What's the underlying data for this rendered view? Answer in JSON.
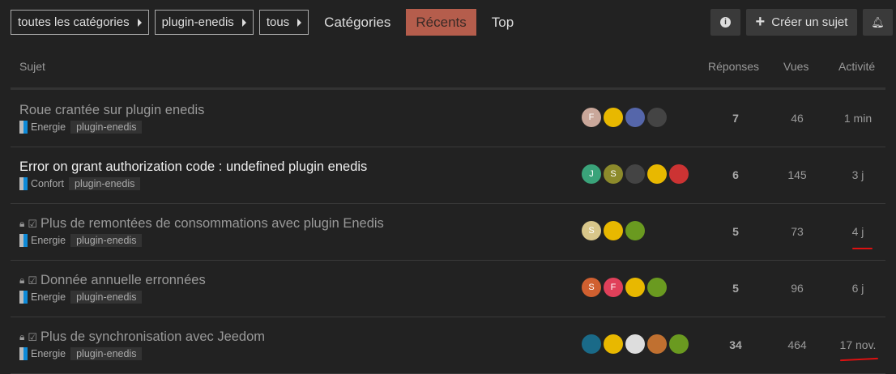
{
  "nav": {
    "crumbs": [
      "toutes les catégories",
      "plugin-enedis",
      "tous"
    ],
    "links": [
      "Catégories",
      "Récents",
      "Top"
    ],
    "active": "Récents"
  },
  "actions": {
    "info_icon": "info-icon",
    "create": "Créer un sujet",
    "bell_icon": "bell-icon"
  },
  "headers": {
    "topic": "Sujet",
    "replies": "Réponses",
    "views": "Vues",
    "activity": "Activité"
  },
  "topics": [
    {
      "title": "Roue crantée sur plugin enedis",
      "category": "Energie",
      "tag": "plugin-enedis",
      "replies": "7",
      "views": "46",
      "activity": "1 min",
      "locked": false,
      "bold": false,
      "avatars": [
        {
          "t": "F",
          "c": "#c9a79a"
        },
        {
          "t": "",
          "c": "#e8b800"
        },
        {
          "t": "",
          "c": "#5566aa"
        },
        {
          "t": "",
          "c": "#444"
        }
      ]
    },
    {
      "title": "Error on grant authorization code : undefined plugin enedis",
      "category": "Confort",
      "tag": "plugin-enedis",
      "replies": "6",
      "views": "145",
      "activity": "3 j",
      "locked": false,
      "bold": true,
      "avatars": [
        {
          "t": "J",
          "c": "#3aa37a"
        },
        {
          "t": "S",
          "c": "#8c8a2b"
        },
        {
          "t": "",
          "c": "#444"
        },
        {
          "t": "",
          "c": "#e8b800"
        },
        {
          "t": "",
          "c": "#c33"
        }
      ]
    },
    {
      "title": "Plus de remontées de consommations avec plugin Enedis",
      "category": "Energie",
      "tag": "plugin-enedis",
      "replies": "5",
      "views": "73",
      "activity": "4 j",
      "locked": true,
      "bold": false,
      "avatars": [
        {
          "t": "S",
          "c": "#d8c68a"
        },
        {
          "t": "",
          "c": "#e8b800"
        },
        {
          "t": "",
          "c": "#6a9a20"
        }
      ]
    },
    {
      "title": "Donnée annuelle erronnées",
      "category": "Energie",
      "tag": "plugin-enedis",
      "replies": "5",
      "views": "96",
      "activity": "6 j",
      "locked": true,
      "bold": false,
      "avatars": [
        {
          "t": "S",
          "c": "#d06030"
        },
        {
          "t": "F",
          "c": "#e0405a"
        },
        {
          "t": "",
          "c": "#e8b800"
        },
        {
          "t": "",
          "c": "#6a9a20"
        }
      ]
    },
    {
      "title": "Plus de synchronisation avec Jeedom",
      "category": "Energie",
      "tag": "plugin-enedis",
      "replies": "34",
      "views": "464",
      "activity": "17 nov.",
      "locked": true,
      "bold": false,
      "avatars": [
        {
          "t": "",
          "c": "#1a6a88"
        },
        {
          "t": "",
          "c": "#e8b800"
        },
        {
          "t": "",
          "c": "#ddd"
        },
        {
          "t": "",
          "c": "#c07030"
        },
        {
          "t": "",
          "c": "#6a9a20"
        }
      ]
    }
  ]
}
